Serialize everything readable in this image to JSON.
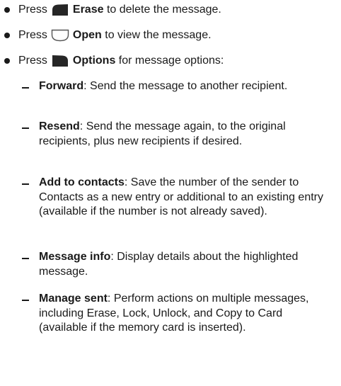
{
  "bullets": [
    {
      "prefix": "Press",
      "key_icon": "left-softkey-icon",
      "label": "Erase",
      "text": "to delete the message."
    },
    {
      "prefix": "Press",
      "key_icon": "center-select-key-icon",
      "label": "Open",
      "text": "to view the message."
    },
    {
      "prefix": "Press",
      "key_icon": "right-softkey-icon",
      "label": "Options",
      "text": "for message options:"
    }
  ],
  "options": [
    {
      "term": "Forward",
      "desc": ": Send the message to another recipient."
    },
    {
      "term": "Resend",
      "desc": ": Send the message again, to the original recipients, plus new recipients if desired."
    },
    {
      "term": "Add to contacts",
      "desc": ": Save the number of the sender to Contacts as a new entry or additional to an existing entry (available if the number is not already saved)."
    },
    {
      "term": "Message info",
      "desc": ": Display details about the highlighted message."
    },
    {
      "term": "Manage sent",
      "desc": ": Perform actions on multiple messages, including Erase, Lock, Unlock, and Copy to Card (available if the memory card is inserted)."
    }
  ],
  "colors": {
    "text": "#1a1a1a",
    "key_fill": "#262626",
    "key_outline": "#555555"
  }
}
